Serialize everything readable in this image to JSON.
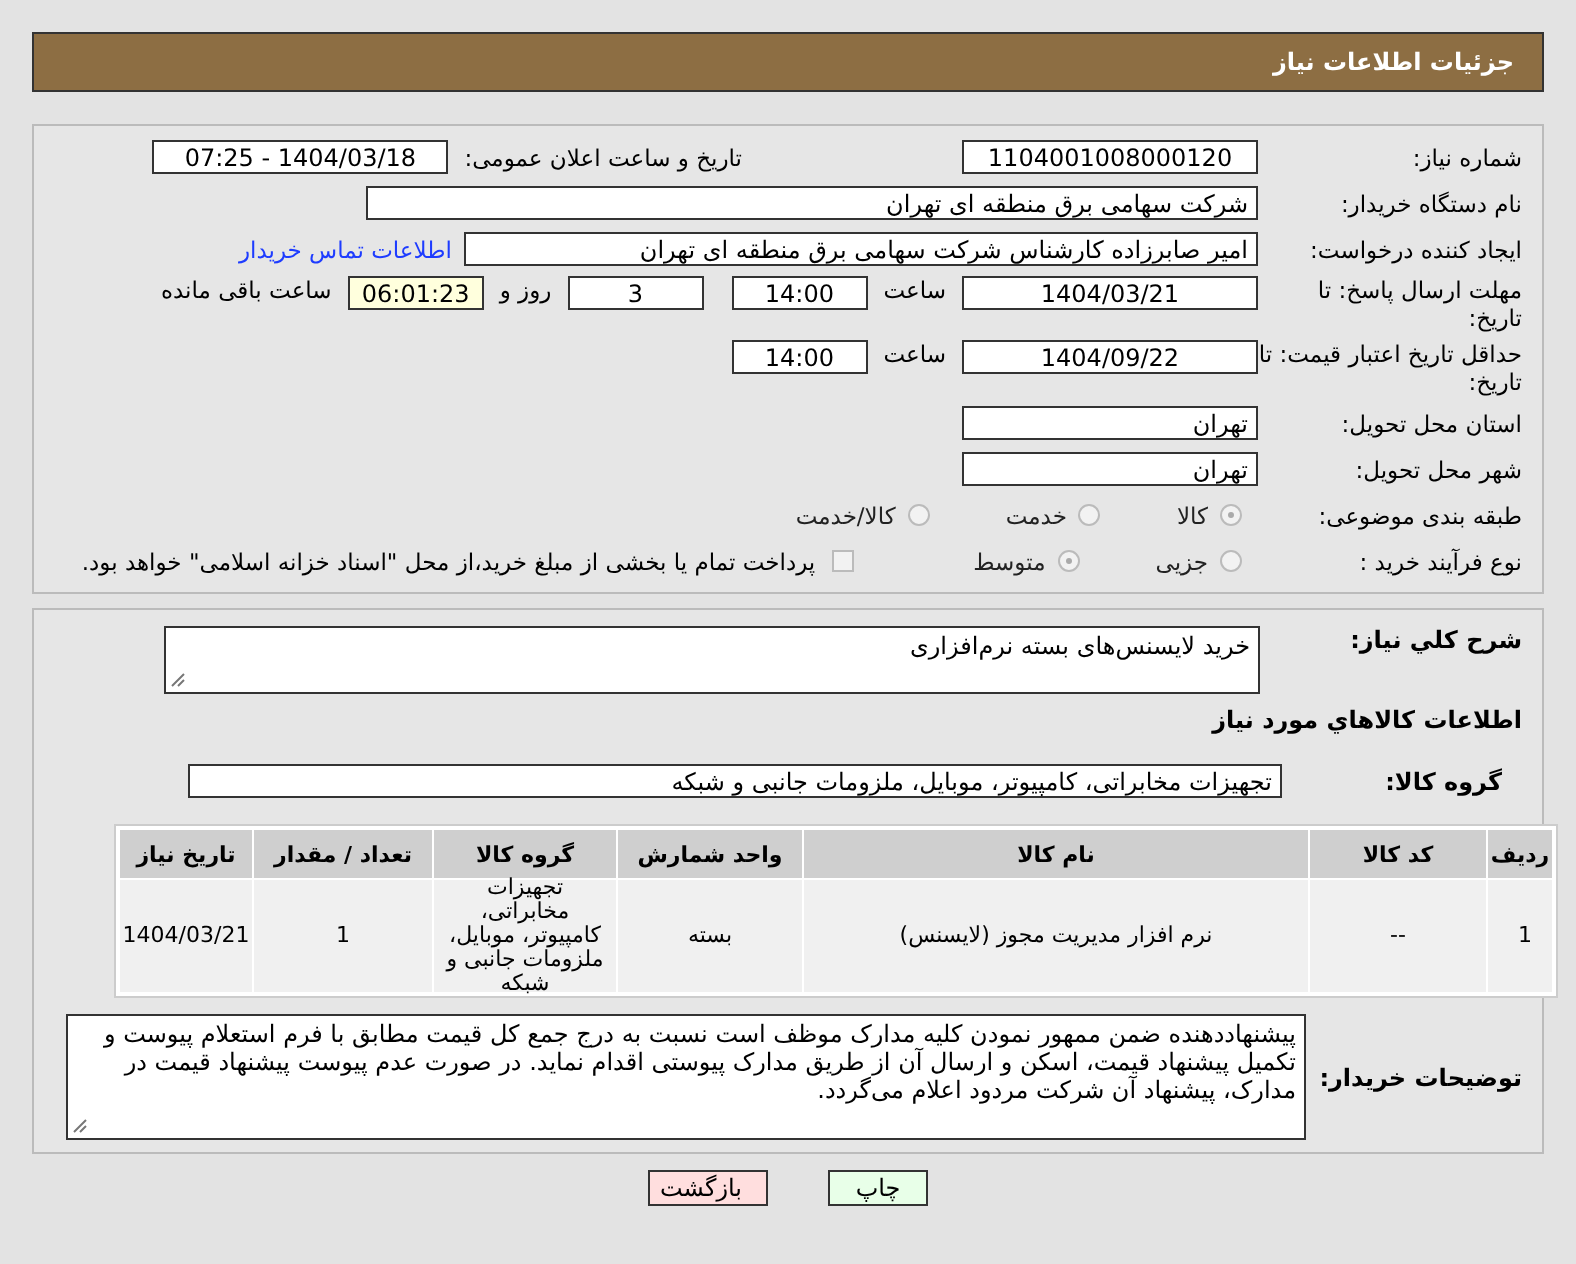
{
  "header": {
    "title": "جزئیات اطلاعات نیاز"
  },
  "need_number": {
    "label": "شماره نیاز:",
    "value": "1104001008000120"
  },
  "announce": {
    "label": "تاریخ و ساعت اعلان عمومی:",
    "value": "1404/03/18 - 07:25"
  },
  "buyer_org": {
    "label": "نام دستگاه خریدار:",
    "value": "شرکت سهامی برق منطقه ای تهران"
  },
  "creator": {
    "label": "ایجاد کننده درخواست:",
    "value": "امیر صابرزاده کارشناس شرکت سهامی برق منطقه ای تهران",
    "link": "اطلاعات تماس خریدار"
  },
  "deadline": {
    "label": "مهلت ارسال پاسخ: تا تاریخ:",
    "date": "1404/03/21",
    "time_label": "ساعت",
    "time": "14:00",
    "days": "3",
    "days_label": "روز و",
    "remaining": "06:01:23",
    "remaining_label": "ساعت باقی مانده"
  },
  "price_validity": {
    "label": "حداقل تاریخ اعتبار قیمت: تا تاریخ:",
    "date": "1404/09/22",
    "time_label": "ساعت",
    "time": "14:00"
  },
  "province": {
    "label": "استان محل تحویل:",
    "value": "تهران"
  },
  "city": {
    "label": "شهر محل تحویل:",
    "value": "تهران"
  },
  "category": {
    "label": "طبقه بندی موضوعی:",
    "options": [
      {
        "label": "کالا",
        "selected": true
      },
      {
        "label": "خدمت",
        "selected": false
      },
      {
        "label": "کالا/خدمت",
        "selected": false
      }
    ]
  },
  "process": {
    "label": "نوع فرآیند خرید :",
    "options": [
      {
        "label": "جزیی",
        "selected": false
      },
      {
        "label": "متوسط",
        "selected": true
      }
    ],
    "payment": {
      "checked": false,
      "text": "پرداخت تمام یا بخشی از مبلغ خرید،از محل \"اسناد خزانه اسلامی\" خواهد بود."
    }
  },
  "summary": {
    "label": "شرح کلي نياز:",
    "value": "خرید لایسنس‌های بسته نرم‌افزاری"
  },
  "goods_heading": "اطلاعات کالاهاي مورد نياز",
  "goods_group": {
    "label": "گروه کالا:",
    "value": "تجهیزات مخابراتی، کامپیوتر، موبایل، ملزومات جانبی و شبکه"
  },
  "table": {
    "columns": [
      "ردیف",
      "کد کالا",
      "نام کالا",
      "واحد شمارش",
      "گروه کالا",
      "تعداد / مقدار",
      "تاریخ نیاز"
    ],
    "rows": [
      [
        "1",
        "--",
        "نرم افزار مدیریت مجوز (لایسنس)",
        "بسته",
        "تجهیزات مخابراتی، کامپیوتر، موبایل، ملزومات جانبی و شبکه",
        "1",
        "1404/03/21"
      ]
    ]
  },
  "notes": {
    "label": "توضیحات خریدار:",
    "value": "پیشنهاددهنده ضمن ممهور نمودن کلیه مدارک موظف است نسبت به درج جمع کل قیمت مطابق با فرم استعلام پیوست و تکمیل پیشنهاد قیمت، اسکن و ارسال آن از طریق مدارک پیوستی اقدام نماید. در صورت عدم پیوست پیشنهاد قیمت در مدارک، پیشنهاد آن شرکت مردود اعلام می‌گردد."
  },
  "buttons": [
    {
      "label": "چاپ",
      "kind": "print"
    },
    {
      "label": "بازگشت",
      "kind": "back"
    }
  ]
}
